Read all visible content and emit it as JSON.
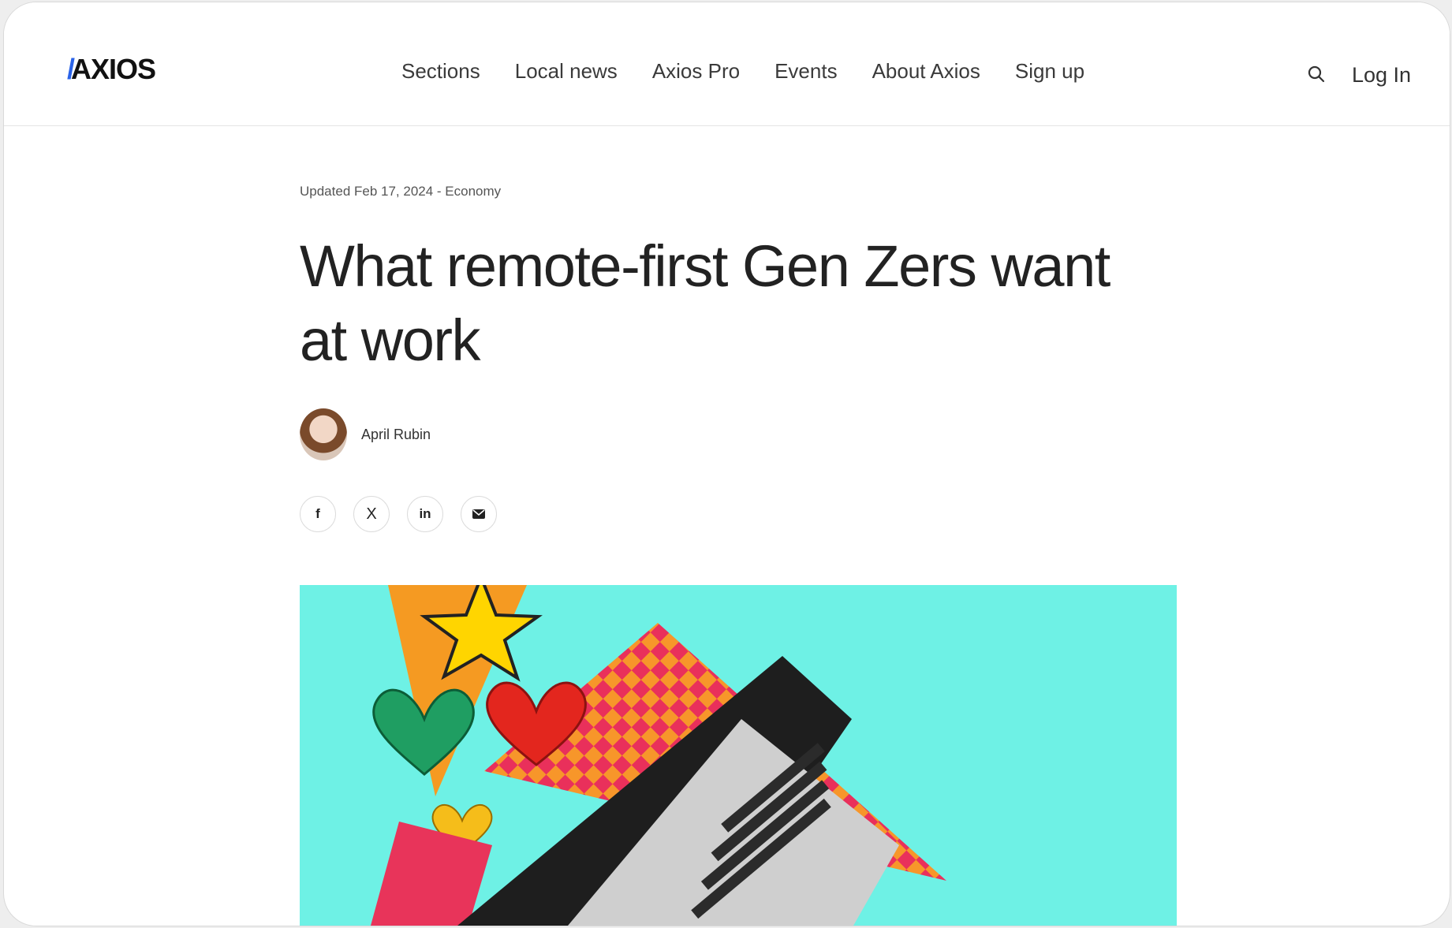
{
  "header": {
    "logo": "AXIOS",
    "nav": [
      "Sections",
      "Local news",
      "Axios Pro",
      "Events",
      "About Axios",
      "Sign up"
    ],
    "search_icon": "search-icon",
    "login_label": "Log In"
  },
  "article": {
    "meta": "Updated Feb 17, 2024 - Economy",
    "headline": "What remote-first Gen Zers want at work",
    "author": "April Rubin",
    "share": {
      "facebook": "f",
      "x": "X",
      "linkedin": "in",
      "email_icon": "email-icon"
    }
  },
  "colors": {
    "brand_accent": "#2a63e8",
    "hero_background": "#6ef1e5"
  }
}
